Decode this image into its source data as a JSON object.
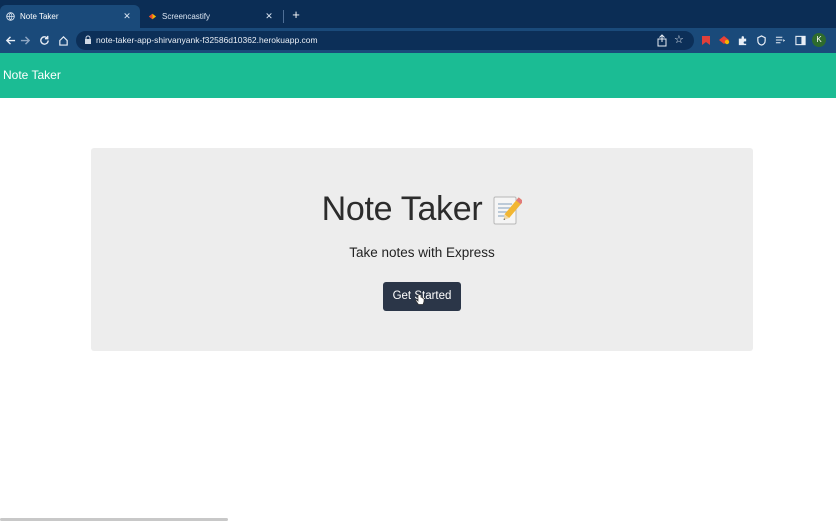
{
  "browser": {
    "tabs": [
      {
        "label": "Note Taker",
        "active": true,
        "close_icon": "close-icon"
      },
      {
        "label": "Screencastify",
        "active": false,
        "close_icon": "close-icon"
      }
    ],
    "new_tab_symbol": "+",
    "url": "note-taker-app-shirvanyank-f32586d10362.herokuapp.com"
  },
  "app": {
    "brand": "Note Taker",
    "colors": {
      "navbar": "#1bbc94",
      "button": "#2b3648",
      "jumbotron": "#ededed"
    }
  },
  "hero": {
    "title": "Note Taker",
    "title_icon": "memo-icon",
    "subtitle": "Take notes with Express",
    "button_label": "Get Started"
  }
}
